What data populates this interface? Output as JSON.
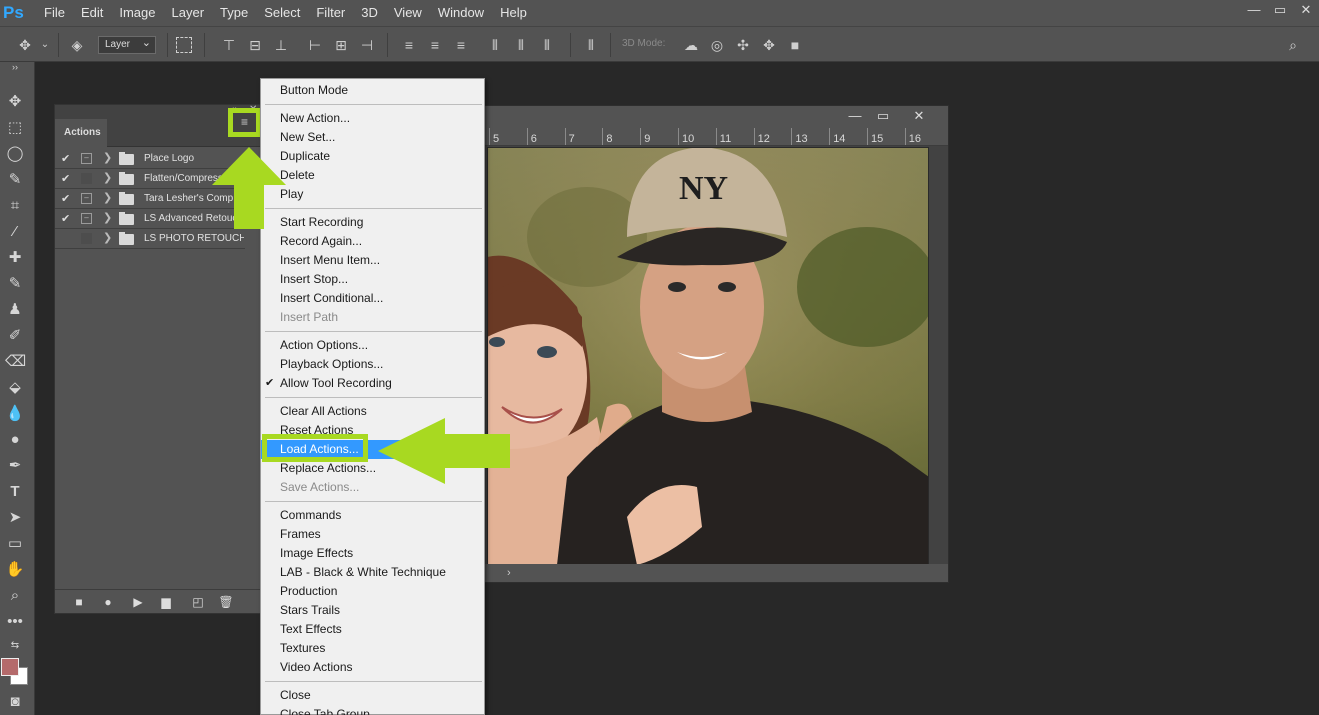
{
  "app": {
    "logo": "Ps"
  },
  "menubar": {
    "items": [
      "File",
      "Edit",
      "Image",
      "Layer",
      "Type",
      "Select",
      "Filter",
      "3D",
      "View",
      "Window",
      "Help"
    ]
  },
  "window_controls": [
    "—",
    "▭",
    "✕"
  ],
  "options_bar": {
    "auto_select_target": "Layer",
    "mode_3d_label": "3D Mode:"
  },
  "actions_panel": {
    "tab_label": "Actions",
    "collapse_glyph": "«",
    "close_glyph": "✕",
    "menu_glyph": "≡",
    "rows": [
      {
        "label": "Place Logo",
        "checked": true,
        "dialog": true
      },
      {
        "label": "Flatten/Compression",
        "checked": true,
        "dialog": false
      },
      {
        "label": "Tara Lesher's Comp",
        "checked": true,
        "dialog": true
      },
      {
        "label": "LS Advanced Retouch",
        "checked": true,
        "dialog": true
      },
      {
        "label": "LS PHOTO RETOUCH",
        "checked": false,
        "dialog": false
      }
    ],
    "bottom_buttons": [
      "stop-icon",
      "record-icon",
      "play-icon",
      "new-set-icon",
      "new-action-icon",
      "trash-icon"
    ]
  },
  "document": {
    "ruler_ticks": [
      "5",
      "6",
      "7",
      "8",
      "9",
      "10",
      "11",
      "12",
      "13",
      "14",
      "15",
      "16"
    ],
    "status_glyph": "›",
    "photo_cap_logo": "NY"
  },
  "context_menu": {
    "groups": [
      [
        {
          "label": "Button Mode"
        }
      ],
      [
        {
          "label": "New Action..."
        },
        {
          "label": "New Set..."
        },
        {
          "label": "Duplicate"
        },
        {
          "label": "Delete"
        },
        {
          "label": "Play"
        }
      ],
      [
        {
          "label": "Start Recording"
        },
        {
          "label": "Record Again..."
        },
        {
          "label": "Insert Menu Item..."
        },
        {
          "label": "Insert Stop..."
        },
        {
          "label": "Insert Conditional..."
        },
        {
          "label": "Insert Path",
          "disabled": true
        }
      ],
      [
        {
          "label": "Action Options..."
        },
        {
          "label": "Playback Options..."
        },
        {
          "label": "Allow Tool Recording",
          "checked": true
        }
      ],
      [
        {
          "label": "Clear All Actions"
        },
        {
          "label": "Reset Actions"
        },
        {
          "label": "Load Actions...",
          "highlight": true
        },
        {
          "label": "Replace Actions..."
        },
        {
          "label": "Save Actions...",
          "disabled": true
        }
      ],
      [
        {
          "label": "Commands"
        },
        {
          "label": "Frames"
        },
        {
          "label": "Image Effects"
        },
        {
          "label": "LAB - Black & White Technique"
        },
        {
          "label": "Production"
        },
        {
          "label": "Stars Trails"
        },
        {
          "label": "Text Effects"
        },
        {
          "label": "Textures"
        },
        {
          "label": "Video Actions"
        }
      ],
      [
        {
          "label": "Close"
        },
        {
          "label": "Close Tab Group"
        }
      ]
    ]
  },
  "colors": {
    "accent_highlight": "#a8d921",
    "menu_selection": "#3399ff",
    "foreground_swatch": "#b46a6b",
    "background_swatch": "#ffffff"
  }
}
